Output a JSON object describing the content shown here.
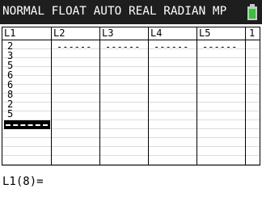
{
  "status": {
    "text": "NORMAL FLOAT AUTO REAL RADIAN MP",
    "battery_icon": "battery-icon",
    "battery_color": "#36c236"
  },
  "editor": {
    "columns": [
      {
        "label": "L1"
      },
      {
        "label": "L2"
      },
      {
        "label": "L3"
      },
      {
        "label": "L4"
      },
      {
        "label": "L5"
      },
      {
        "label": "1"
      }
    ],
    "l1_values": [
      "2",
      "3",
      "5",
      "6",
      "6",
      "8",
      "2",
      "5"
    ],
    "empty_marker": "------"
  },
  "entry": {
    "text": "L1(8)="
  }
}
